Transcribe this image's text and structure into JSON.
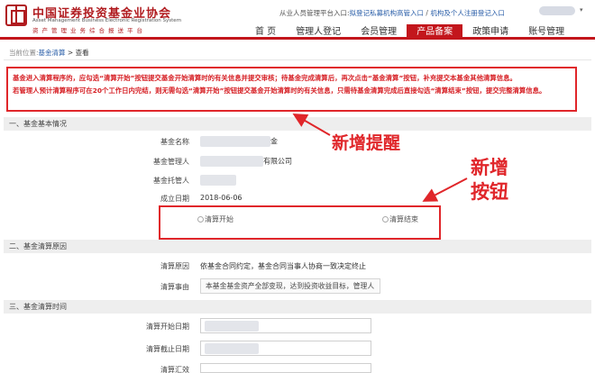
{
  "header": {
    "org_cn": "中国证券投资基金业协会",
    "org_en": "Asset Management Business Electronic Registration System",
    "org_sub": "资产管理业务综合报送平台",
    "toplinks": {
      "prefix": "从业人员管理平台入口:",
      "link1": "拟登记私募机构高管入口",
      "sep": " / ",
      "link2": "机构及个人注册登记入口"
    },
    "user_caret": "▾"
  },
  "nav": {
    "items": [
      {
        "label": "首 页"
      },
      {
        "label": "管理人登记"
      },
      {
        "label": "会员管理"
      },
      {
        "label": "产品备案"
      },
      {
        "label": "政策申请"
      },
      {
        "label": "账号管理"
      }
    ]
  },
  "breadcrumb": {
    "prefix": "当前位置:",
    "link": "基金清算",
    "sep": " > ",
    "current": "查看"
  },
  "notice": {
    "lines": [
      "基金进入清算程序的，应勾选“清算开始”按钮提交基金开始清算时的有关信息并提交审核；待基金完成清算后，再次点击“基金清算”按钮，补充提交本基金其他清算信息。",
      "若管理人预计清算程序可在20个工作日内完结，则无需勾选“清算开始”按钮提交基金开始清算时的有关信息，只需待基金清算完成后直接勾选“清算结束”按钮，提交完整清算信息。"
    ]
  },
  "section1": {
    "title": "一、基金基本情况",
    "fund_name_label": "基金名称",
    "fund_name_suffix": "金",
    "manager_label": "基金管理人",
    "manager_suffix": "有限公司",
    "custodian_label": "基金托管人",
    "setup_date_label": "成立日期",
    "setup_date_value": "2018-06-06",
    "radio_start": "清算开始",
    "radio_end": "清算结束"
  },
  "section2": {
    "title": "二、基金清算原因",
    "reason_label": "清算原因",
    "reason_value": "依基金合同约定，基金合同当事人协商一致决定终止",
    "cause_label": "清算事由",
    "cause_value": "本基金基金资产全部变现，达到投资收益目标，管理人"
  },
  "section3": {
    "title": "三、基金清算时间",
    "start_label": "清算开始日期",
    "end_label": "清算截止日期",
    "third_label": "清算汇效"
  },
  "callouts": {
    "reminder": "新增提醒",
    "button_line1": "新增",
    "button_line2": "按钮"
  },
  "colors": {
    "brand_red": "#c3161c",
    "notice_red": "#d61f24",
    "link_blue": "#2a5ea8"
  }
}
